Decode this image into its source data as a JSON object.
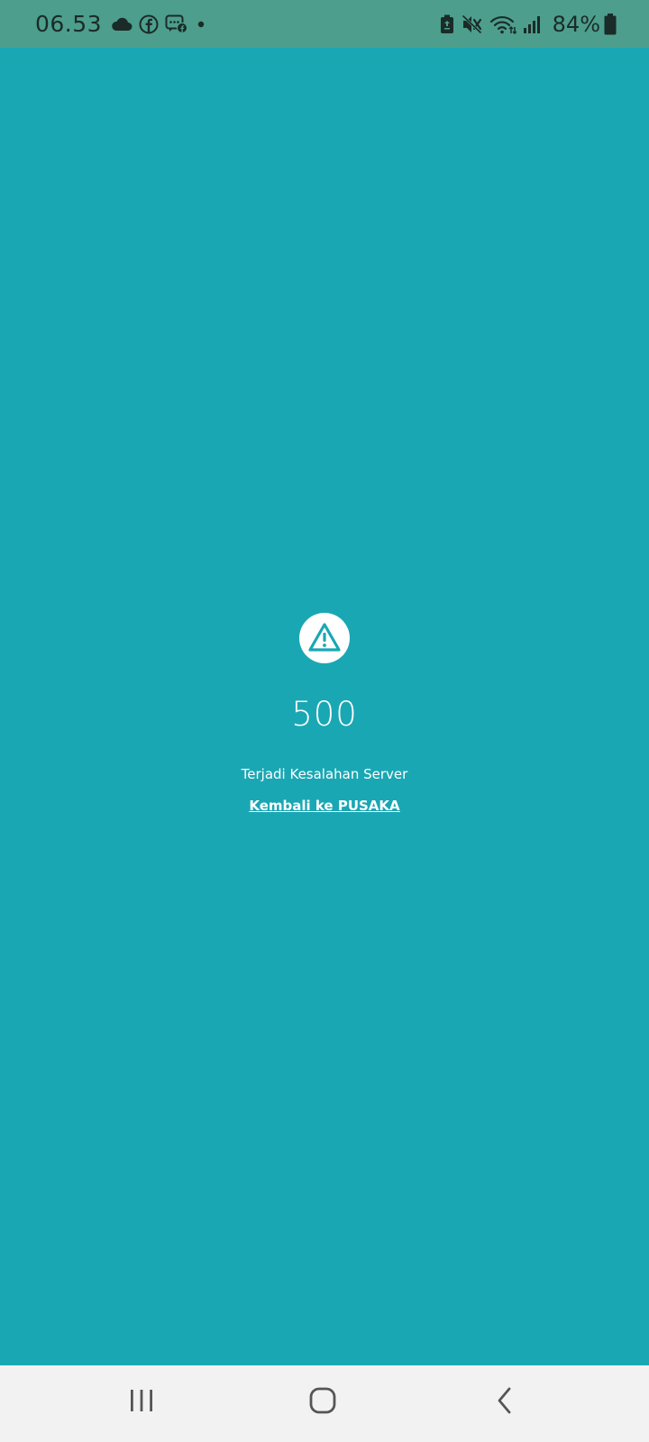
{
  "status_bar": {
    "time": "06.53",
    "battery_percent": "84%",
    "notification_icons": [
      "cloud-icon",
      "facebook-icon",
      "messenger-icon",
      "dot-icon"
    ],
    "system_icons": [
      "battery-saver-icon",
      "mute-icon",
      "wifi-icon",
      "signal-icon",
      "battery-icon"
    ]
  },
  "error_page": {
    "icon": "warning-triangle-icon",
    "code": "500",
    "message": "Terjadi Kesalahan Server",
    "back_link": "Kembali ke PUSAKA"
  },
  "nav_bar": {
    "buttons": [
      "recent-apps",
      "home",
      "back"
    ]
  },
  "colors": {
    "background": "#1aa7b4",
    "status_bar": "#4d9e8d",
    "nav_bar": "#f2f2f2",
    "text": "#ffffff"
  }
}
